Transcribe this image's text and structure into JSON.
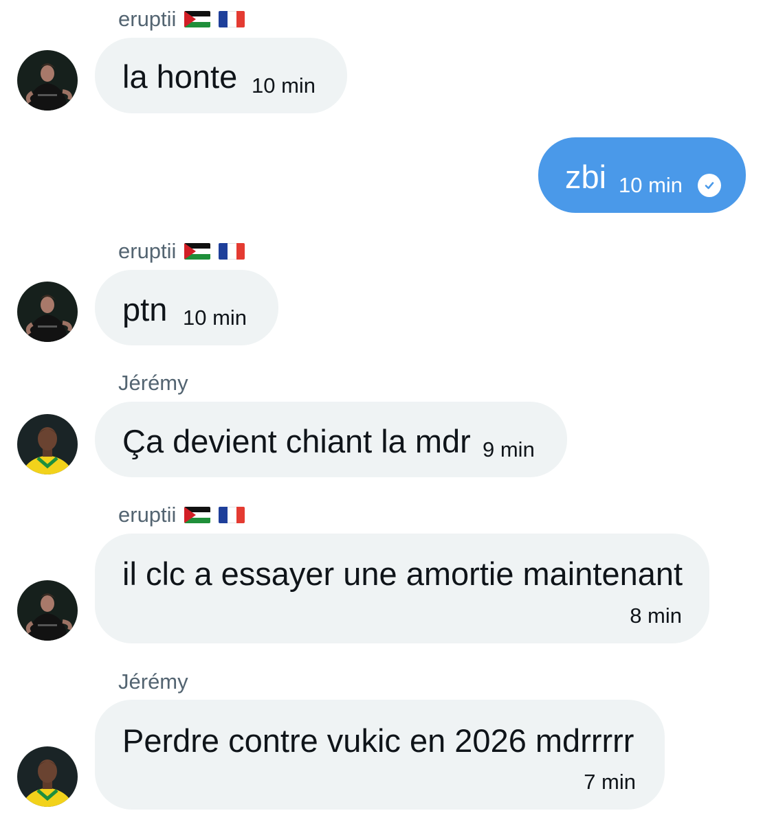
{
  "users": {
    "eruptii": "eruptii",
    "jeremy": "Jérémy"
  },
  "messages": [
    {
      "sender": "eruptii",
      "text": "la honte",
      "time": "10 min",
      "outgoing": false
    },
    {
      "text": "zbi",
      "time": "10 min",
      "outgoing": true,
      "status": "seen-check-icon"
    },
    {
      "sender": "eruptii",
      "text": "ptn",
      "time": "10 min",
      "outgoing": false
    },
    {
      "sender": "Jérémy",
      "text": "Ça devient chiant la mdr",
      "time": "9 min",
      "outgoing": false
    },
    {
      "sender": "eruptii",
      "text": "il clc a essayer une amortie maintenant",
      "time": "8 min",
      "outgoing": false
    },
    {
      "sender": "Jérémy",
      "text": "Perdre contre vukic en 2026 mdrrrrr",
      "time": "7 min",
      "outgoing": false
    }
  ],
  "colors": {
    "incoming_bubble": "#eff3f4",
    "outgoing_bubble": "#4a99e9",
    "sender_name": "#536471"
  },
  "icons": [
    "palestine-flag-icon",
    "france-flag-icon",
    "seen-check-icon"
  ]
}
